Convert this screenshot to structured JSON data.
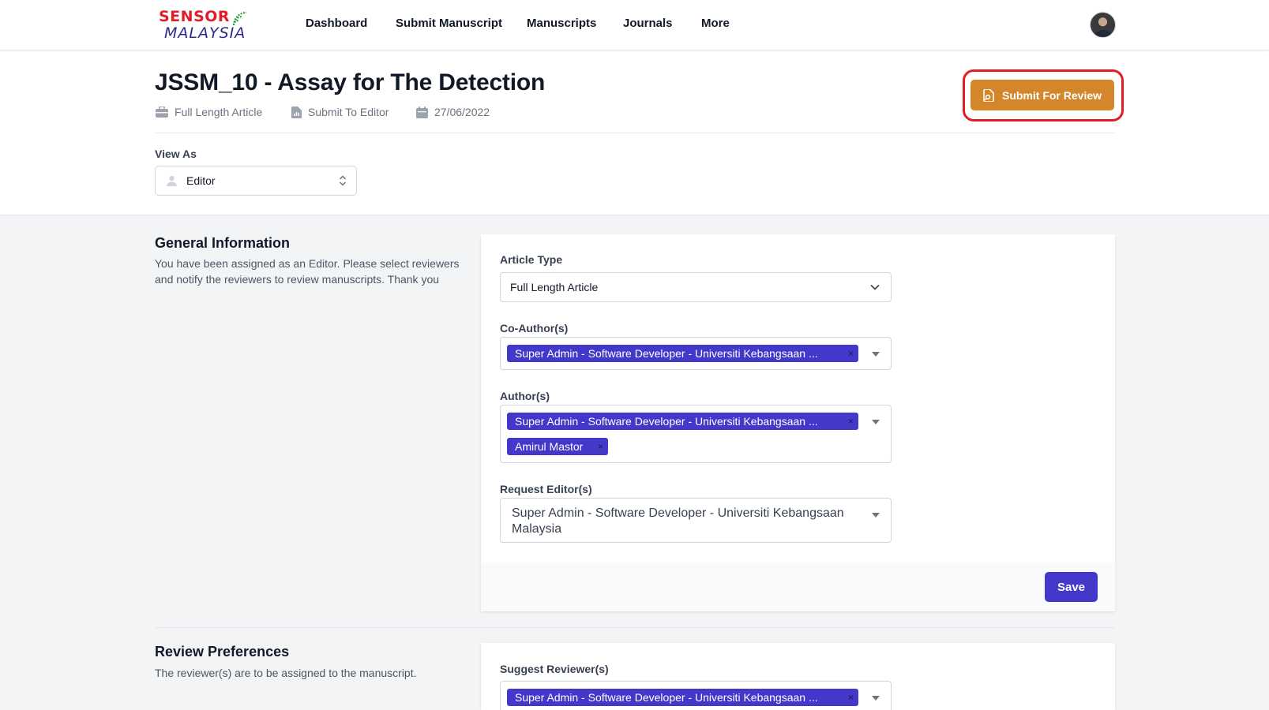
{
  "brand": {
    "logo_top": "SENSOR",
    "logo_bottom": "MALAYSIA"
  },
  "nav": {
    "items": [
      "Dashboard",
      "Submit Manuscript",
      "Manuscripts",
      "Journals",
      "More"
    ]
  },
  "header": {
    "title": "JSSM_10 - Assay for The Detection",
    "meta_type": "Full Length Article",
    "meta_status": "Submit To Editor",
    "meta_date": "27/06/2022",
    "submit_label": "Submit For Review"
  },
  "view_as": {
    "label": "View As",
    "value": "Editor"
  },
  "general": {
    "title": "General Information",
    "description": "You have been assigned as an Editor. Please select reviewers and notify the reviewers to review manuscripts. Thank you",
    "article_type_label": "Article Type",
    "article_type_value": "Full Length Article",
    "coauthors_label": "Co-Author(s)",
    "coauthors": [
      "Super Admin - Software Developer - Universiti Kebangsaan ..."
    ],
    "authors_label": "Author(s)",
    "authors": [
      "Super Admin - Software Developer - Universiti Kebangsaan ...",
      "Amirul Mastor"
    ],
    "request_editor_label": "Request Editor(s)",
    "request_editor_value": "Super Admin - Software Developer - Universiti Kebangsaan Malaysia",
    "save_label": "Save"
  },
  "review": {
    "title": "Review Preferences",
    "description": "The reviewer(s) are to be assigned to the manuscript.",
    "suggest_label": "Suggest Reviewer(s)",
    "suggested": [
      "Super Admin - Software Developer - Universiti Kebangsaan ..."
    ]
  },
  "tag_remove_symbol": "×",
  "colors": {
    "accent": "#4338ca",
    "submit": "#d4862b",
    "highlight": "#e11d24",
    "brand_red": "#e11d2a",
    "brand_blue": "#2e2a8a"
  }
}
